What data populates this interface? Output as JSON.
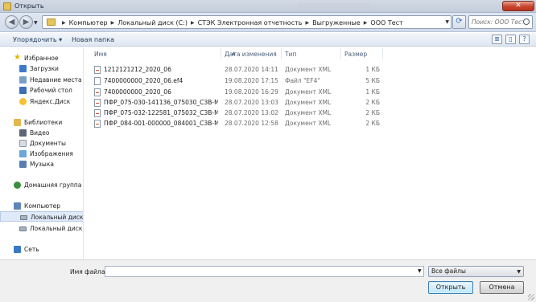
{
  "window": {
    "title": "Открыть",
    "close_label": "✕"
  },
  "nav": {
    "back_glyph": "◀",
    "forward_glyph": "▶",
    "breadcrumbs": [
      "Компьютер",
      "Локальный диск (C:)",
      "СТЭК Электронная отчетность",
      "Выгруженные",
      "ООО Тест"
    ],
    "separator": "▶",
    "refresh_glyph": "⟳",
    "search_placeholder": "Поиск: ООО Тест"
  },
  "toolbar": {
    "organize_label": "Упорядочить ▾",
    "new_folder_label": "Новая папка"
  },
  "sidebar": {
    "favorites": {
      "label": "Избранное",
      "items": [
        "Загрузки",
        "Недавние места",
        "Рабочий стол",
        "Яндекс.Диск"
      ]
    },
    "libraries": {
      "label": "Библиотеки",
      "items": [
        "Видео",
        "Документы",
        "Изображения",
        "Музыка"
      ]
    },
    "homegroup": {
      "label": "Домашняя группа"
    },
    "computer": {
      "label": "Компьютер",
      "items": [
        "Локальный диск (C:)",
        "Локальный диск (D:)"
      ]
    },
    "network": {
      "label": "Сеть"
    }
  },
  "columns": {
    "name": "Имя",
    "date": "Дата изменения",
    "type": "Тип",
    "size": "Размер"
  },
  "files": [
    {
      "name": "1212121212_2020_06",
      "date": "28.07.2020 14:11",
      "type": "Документ XML",
      "size": "1 КБ",
      "icon": "xml"
    },
    {
      "name": "7400000000_2020_06.ef4",
      "date": "19.08.2020 17:15",
      "type": "Файл \"EF4\"",
      "size": "5 КБ",
      "icon": "file"
    },
    {
      "name": "7400000000_2020_06",
      "date": "19.08.2020 16:29",
      "type": "Документ XML",
      "size": "1 КБ",
      "icon": "xml"
    },
    {
      "name": "ПФР_075-030-141136_075030_СЗВ-М_2020...",
      "date": "28.07.2020 13:03",
      "type": "Документ XML",
      "size": "2 КБ",
      "icon": "xml"
    },
    {
      "name": "ПФР_075-032-122581_075032_СЗВ-М_2020...",
      "date": "28.07.2020 13:02",
      "type": "Документ XML",
      "size": "2 КБ",
      "icon": "xml"
    },
    {
      "name": "ПФР_084-001-000000_084001_СЗВ-М_2020...",
      "date": "28.07.2020 12:58",
      "type": "Документ XML",
      "size": "2 КБ",
      "icon": "xml"
    }
  ],
  "footer": {
    "filename_label": "Имя файла:",
    "filename_value": "",
    "filetype_value": "Все файлы",
    "open_label": "Открыть",
    "cancel_label": "Отмена"
  },
  "colors": {
    "accent": "#3c7fb1",
    "close": "#c7432c",
    "selected": "#dfe9f7"
  }
}
